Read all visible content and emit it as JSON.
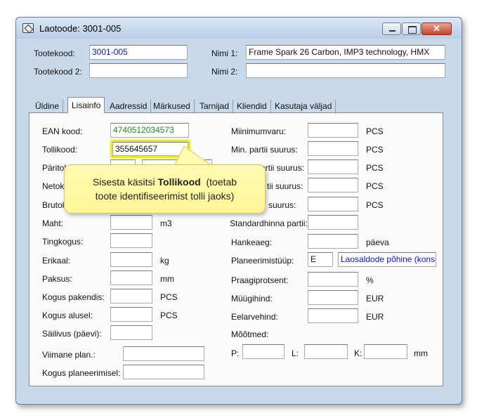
{
  "window": {
    "title": "Laotoode: 3001-005"
  },
  "header": {
    "tootekood_label": "Tootekood:",
    "tootekood_value": "3001-005",
    "tootekood2_label": "Tootekood 2:",
    "tootekood2_value": "",
    "nimi1_label": "Nimi 1:",
    "nimi1_value": "Frame Spark 26 Carbon, IMP3 technology, HMX",
    "nimi2_label": "Nimi 2:",
    "nimi2_value": ""
  },
  "tabs": [
    "Üldine",
    "Lisainfo",
    "Aadressid",
    "Märkused",
    "Tarnijad",
    "Kliendid",
    "Kasutaja väljad"
  ],
  "left_fields": {
    "ean_label": "EAN kood:",
    "ean_value": "4740512034573",
    "tollikood_label": "Tollikood:",
    "tollikood_value": "355645657",
    "paritolumaa_label": "Päritolumaa:",
    "neto_label": "Netok",
    "bruto_label": "Brutok",
    "maht_label": "Maht:",
    "maht_unit": "m3",
    "tingkogus_label": "Tingkogus:",
    "erikaal_label": "Erikaal:",
    "erikaal_unit": "kg",
    "paksus_label": "Paksus:",
    "paksus_unit": "mm",
    "kogus_pakendis_label": "Kogus pakendis:",
    "kogus_pakendis_unit": "PCS",
    "kogus_alusel_label": "Kogus alusel:",
    "kogus_alusel_unit": "PCS",
    "sailivus_label": "Säilivus (päevi):",
    "viimane_plan_label": "Viimane plan.:",
    "kogus_planeerimisel_label": "Kogus planeerimisel:"
  },
  "right_fields": {
    "miinimumvaru_label": "Miinimumvaru:",
    "miinimumvaru_unit": "PCS",
    "min_partii_label": "Min. partii suurus:",
    "min_partii_unit": "PCS",
    "maks_partii_label": "Maks. partii suurus:",
    "maks_partii_unit": "PCS",
    "tii_suurus1_label": "tii suurus:",
    "tii_suurus1_unit": "PCS",
    "suurus2_label": "suurus:",
    "suurus2_unit": "PCS",
    "standardhinna_label": "Standardhinna partii:",
    "hankeaeg_label": "Hankeaeg:",
    "hankeaeg_unit": "päeva",
    "planeerimistuup_label": "Planeerimistüüp:",
    "planeerimistuup_code": "E",
    "planeerimistuup_desc": "Laosaldode põhine (konse",
    "praagiprotsent_label": "Praagiprotsent:",
    "praagiprotsent_unit": "%",
    "muugihind_label": "Müügihind:",
    "muugihind_unit": "EUR",
    "eelarvehind_label": "Eelarvehind:",
    "eelarvehind_unit": "EUR",
    "mootmed_label": "Mõõtmed:",
    "p_label": "P:",
    "l_label": "L:",
    "k_label": "K:",
    "mootmed_unit": "mm"
  },
  "callout": {
    "text_before": "Sisesta käsitsi ",
    "text_bold": "Tollikood",
    "text_after": "  (toetab",
    "line2": "toote identifiseerimist tolli jaoks)"
  }
}
